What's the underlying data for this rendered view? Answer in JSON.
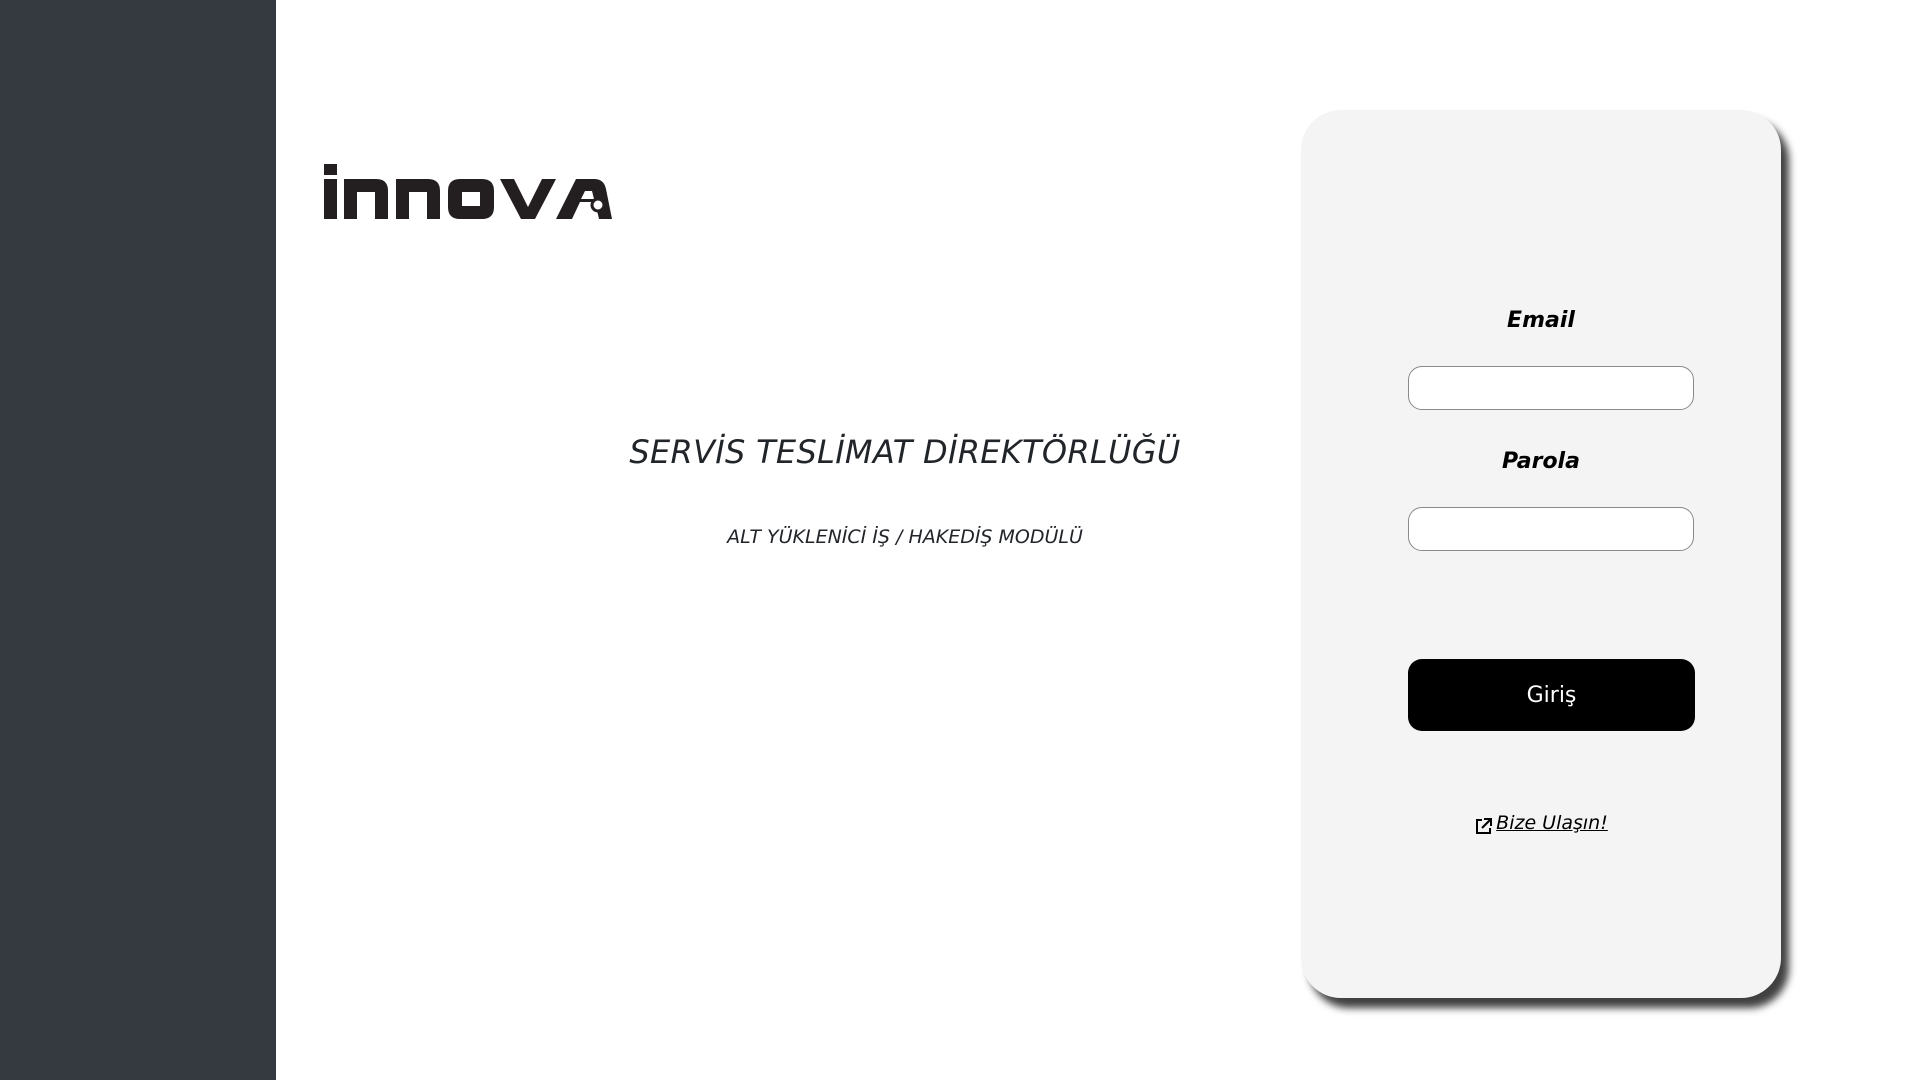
{
  "brand": {
    "logo_text": "iNNOVA"
  },
  "main": {
    "title": "SERVİS TESLİMAT DİREKTÖRLÜĞÜ",
    "subtitle": "ALT YÜKLENİCİ İŞ / HAKEDİŞ MODÜLÜ"
  },
  "login": {
    "email_label": "Email",
    "email_value": "",
    "password_label": "Parola",
    "password_value": "",
    "submit_label": "Giriş",
    "contact_link_label": "Bize Ulaşın!",
    "contact_icon": "external-link-icon"
  },
  "colors": {
    "sidebar": "#343a40",
    "card_background": "#f4f4f4",
    "button_background": "#000000",
    "button_text": "#ffffff"
  }
}
